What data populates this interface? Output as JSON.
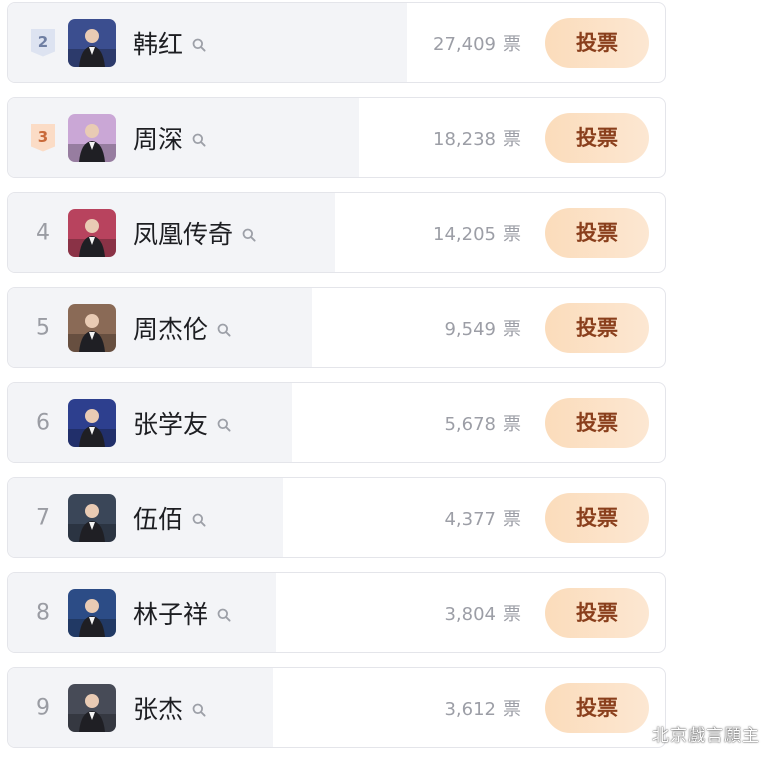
{
  "vote_unit": "票",
  "vote_button_label": "投票",
  "rows": [
    {
      "rank": "2",
      "name": "韩红",
      "votes": "27,409",
      "share": 0.607,
      "medal": "silver",
      "avatar_color": "#3b4e8f"
    },
    {
      "rank": "3",
      "name": "周深",
      "votes": "18,238",
      "share": 0.535,
      "medal": "bronze",
      "avatar_color": "#caa7d6"
    },
    {
      "rank": "4",
      "name": "凤凰传奇",
      "votes": "14,205",
      "share": 0.498,
      "medal": "",
      "avatar_color": "#b8435e"
    },
    {
      "rank": "5",
      "name": "周杰伦",
      "votes": "9,549",
      "share": 0.462,
      "medal": "",
      "avatar_color": "#8a6a56"
    },
    {
      "rank": "6",
      "name": "张学友",
      "votes": "5,678",
      "share": 0.432,
      "medal": "",
      "avatar_color": "#2d3f8e"
    },
    {
      "rank": "7",
      "name": "伍佰",
      "votes": "4,377",
      "share": 0.418,
      "medal": "",
      "avatar_color": "#3a4658"
    },
    {
      "rank": "8",
      "name": "林子祥",
      "votes": "3,804",
      "share": 0.408,
      "medal": "",
      "avatar_color": "#2c4c86"
    },
    {
      "rank": "9",
      "name": "张杰",
      "votes": "3,612",
      "share": 0.403,
      "medal": "",
      "avatar_color": "#474b57"
    }
  ],
  "watermark": "北京戲言願主"
}
